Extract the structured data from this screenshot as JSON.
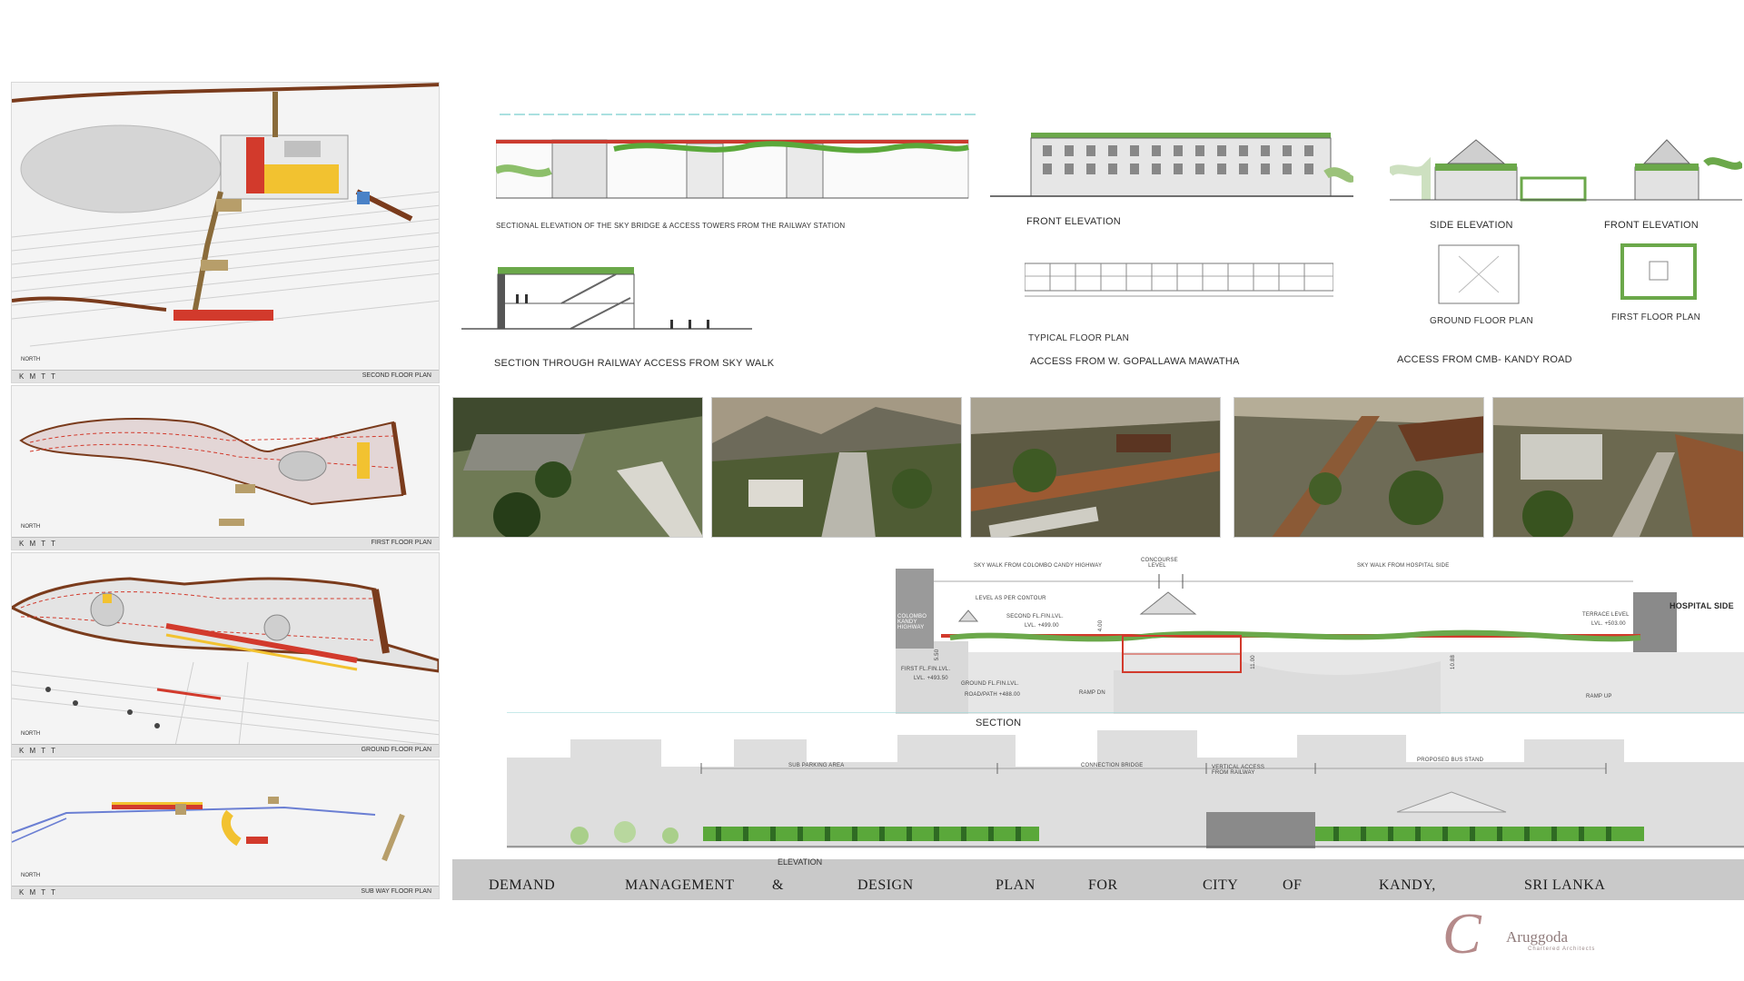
{
  "left_panels": [
    {
      "code": "K M T T",
      "name": "SECOND FLOOR PLAN",
      "north": "NORTH"
    },
    {
      "code": "K M T T",
      "name": "FIRST FLOOR PLAN",
      "north": "NORTH"
    },
    {
      "code": "K M T T",
      "name": "GROUND FLOOR PLAN",
      "north": "NORTH"
    },
    {
      "code": "K M T T",
      "name": "SUB WAY FLOOR PLAN",
      "north": "NORTH"
    }
  ],
  "drawings": {
    "sky_bridge_section": "SECTIONAL ELEVATION OF THE SKY BRIDGE & ACCESS TOWERS FROM THE RAILWAY STATION",
    "railway_access_section": "SECTION THROUGH RAILWAY ACCESS FROM SKY WALK",
    "front_elevation": "FRONT ELEVATION",
    "typical_floor_plan": "TYPICAL FLOOR PLAN",
    "gopallawa_access": "ACCESS FROM W. GOPALLAWA MAWATHA",
    "side_elevation": "SIDE ELEVATION",
    "front_elevation_2": "FRONT ELEVATION",
    "ground_floor_plan": "GROUND FLOOR PLAN",
    "first_floor_plan": "FIRST FLOOR  PLAN",
    "kandy_road_access": "ACCESS FROM CMB- KANDY ROAD"
  },
  "section": {
    "title": "SECTION",
    "skywalk_colombo": "SKY WALK FROM COLOMBO CANDY HIGHWAY",
    "concourse": "CONCOURSE LEVEL",
    "skywalk_hospital": "SKY WALK FROM HOSPITAL SIDE",
    "hospital_side": "HOSPITAL SIDE",
    "colombo_highway": "COLOMBO KANDY HIGHWAY",
    "level_contour": "LEVEL AS PER CONTOUR",
    "second_fl": "SECOND FL.FIN.LVL.",
    "lvl_499": "LVL. +499.00",
    "first_fl": "FIRST FL.FIN.LVL.",
    "lvl_493": "LVL. +493.50",
    "ground_fl": "GROUND FL.FIN.LVL.",
    "road_path": "ROAD/PATH +488.00",
    "ramp_dn": "RAMP DN",
    "ramp_up": "RAMP UP",
    "terrace": "TERRACE LEVEL",
    "terrace_lvl": "LVL. +503.00",
    "dim_400": "4.00",
    "dim_550": "5.50",
    "dim_1100": "11.00",
    "dim_1088": "10.88"
  },
  "elevation_strip": {
    "label": "ELEVATION",
    "parking": "SUB PARKING AREA",
    "bridge": "CONNECTION BRIDGE",
    "vertical": "VERTICAL ACCESS FROM RAILWAY",
    "stand": "PROPOSED BUS STAND"
  },
  "footer_words": [
    "DEMAND",
    "MANAGEMENT",
    "&",
    "DESIGN",
    "PLAN",
    "FOR",
    "CITY",
    "OF",
    "KANDY,",
    "SRI LANKA"
  ],
  "logo": {
    "mark": "C",
    "word": "Aruggoda",
    "sub": "Chartered Architects"
  },
  "colors": {
    "brown": "#7a3b1c",
    "yellow": "#f2c230",
    "red": "#d23a2c",
    "green": "#5aa83a",
    "sky": "#c9d7ea"
  }
}
